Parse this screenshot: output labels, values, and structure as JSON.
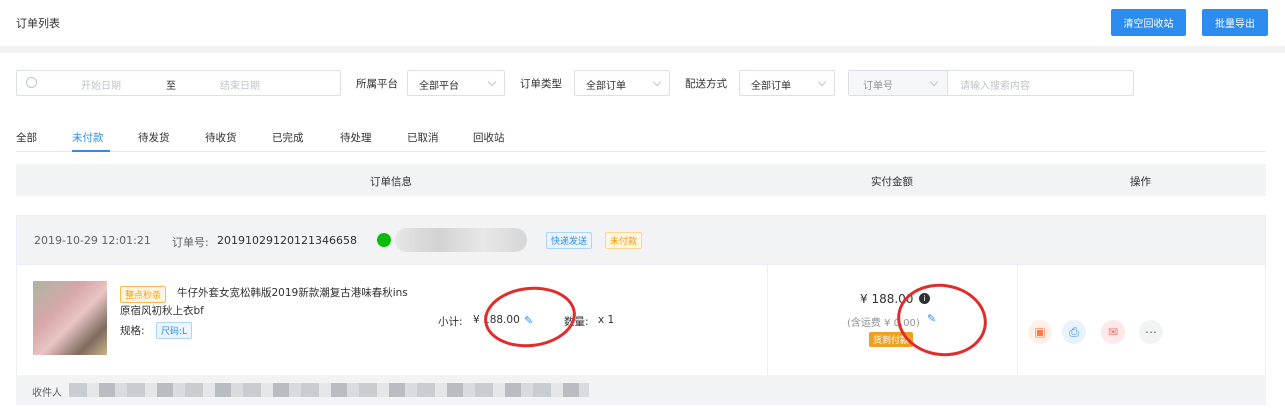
{
  "header": {
    "title": "订单列表",
    "clear_recycle": "清空回收站",
    "batch_export": "批量导出"
  },
  "filters": {
    "start_date": "开始日期",
    "to": "至",
    "end_date": "结束日期",
    "platform_label": "所属平台",
    "platform_value": "全部平台",
    "type_label": "订单类型",
    "type_value": "全部订单",
    "delivery_label": "配送方式",
    "delivery_value": "全部订单",
    "search_field": "订单号",
    "search_placeholder": "请输入搜索内容"
  },
  "tabs": [
    "全部",
    "未付款",
    "待发货",
    "待收货",
    "已完成",
    "待处理",
    "已取消",
    "回收站"
  ],
  "table_headers": {
    "order_info": "订单信息",
    "paid_amount": "实付金额",
    "actions": "操作"
  },
  "order": {
    "datetime": "2019-10-29 12:01:21",
    "order_no_label": "订单号:",
    "order_no": "20191029120121346658",
    "tag_delivery": "快递发送",
    "tag_status": "未付款",
    "product_tag": "整点秒杀",
    "product_title_line1": "牛仔外套女宽松韩版2019新款潮复古港味春秋ins",
    "product_title_line2": "原宿风初秋上衣bf",
    "spec_label": "规格:",
    "spec_value": "尺码:L",
    "subtotal_label": "小计:",
    "subtotal_value": "¥ 188.00",
    "qty_label": "数量:",
    "qty_value": "x 1",
    "paid_amount": "¥ 188.00",
    "shipping": "(含运费 ¥ 0.00)",
    "cod": "货到付款",
    "receiver_label": "收件人"
  },
  "colors": {
    "accent": "#2d8cf0",
    "wechat": "#09bb07",
    "orange": "#ff9900",
    "red_mark": "#e32b2b"
  }
}
